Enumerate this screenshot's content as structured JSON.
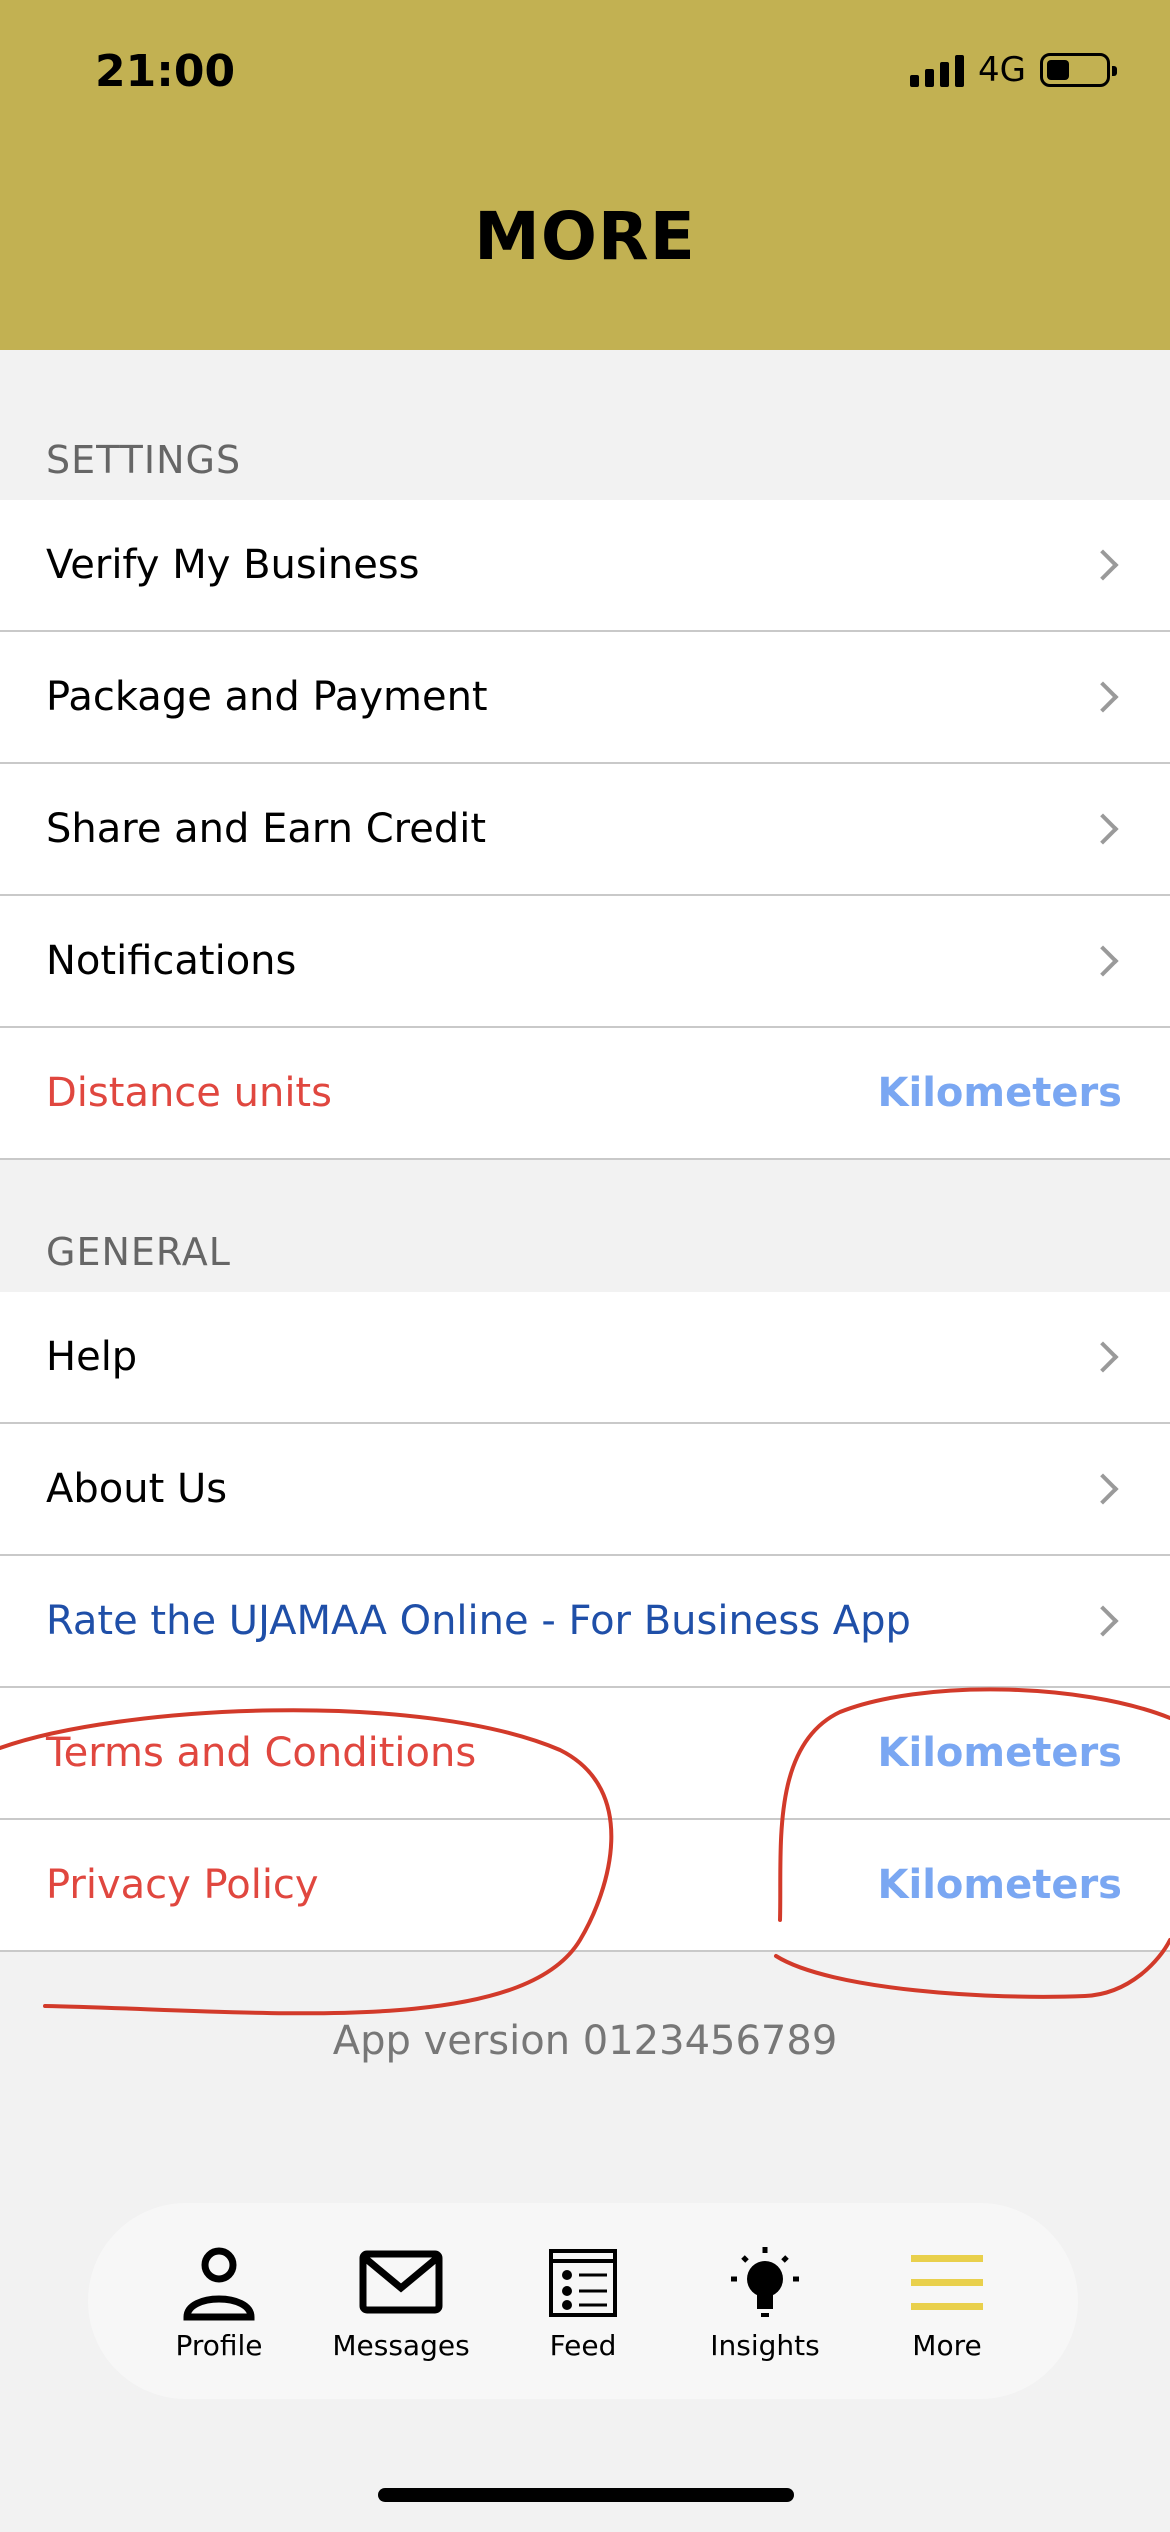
{
  "status_bar": {
    "time": "21:00",
    "network": "4G"
  },
  "header": {
    "title": "MORE"
  },
  "settings": {
    "section_label": "SETTINGS",
    "items": [
      {
        "label": "Verify My Business"
      },
      {
        "label": "Package and Payment"
      },
      {
        "label": "Share and Earn Credit"
      },
      {
        "label": "Notifications"
      },
      {
        "label": "Distance units",
        "value": "Kilometers"
      }
    ]
  },
  "general": {
    "section_label": "GENERAL",
    "items": [
      {
        "label": "Help"
      },
      {
        "label": "About Us"
      },
      {
        "label": "Rate the UJAMAA Online - For Business App"
      },
      {
        "label": "Terms and Conditions",
        "value": "Kilometers"
      },
      {
        "label": "Privacy Policy",
        "value": "Kilometers"
      }
    ]
  },
  "app_version": "App version 0123456789",
  "tabbar": {
    "tabs": [
      {
        "label": "Profile",
        "icon": "person-icon"
      },
      {
        "label": "Messages",
        "icon": "envelope-icon"
      },
      {
        "label": "Feed",
        "icon": "feed-icon"
      },
      {
        "label": "Insights",
        "icon": "lightbulb-icon"
      },
      {
        "label": "More",
        "icon": "hamburger-icon",
        "active": true
      }
    ]
  },
  "colors": {
    "header_bg": "#c2b152",
    "red_text": "#e0473f",
    "blue_link": "#1f4fa8",
    "value_blue": "#7aa7f2",
    "active_tab_accent": "#e9d04c",
    "annotation_red": "#d23a2a"
  }
}
